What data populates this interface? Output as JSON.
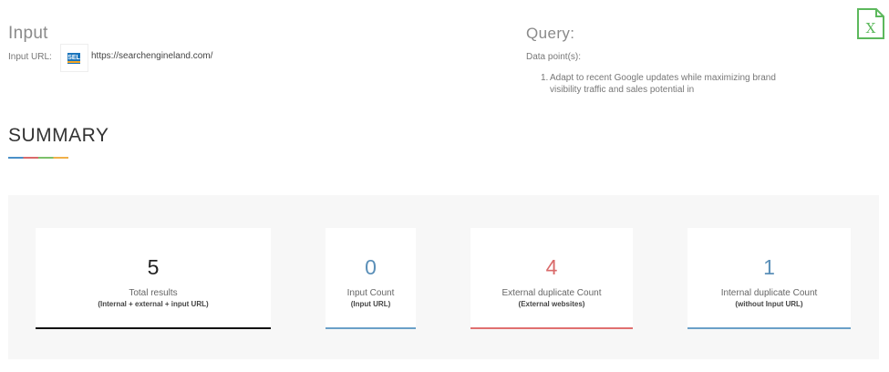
{
  "input": {
    "title": "Input",
    "url_label": "Input URL:",
    "logo_text": "SEL",
    "url_value": "https://searchengineland.com/"
  },
  "query": {
    "title": "Query:",
    "data_points_label": "Data point(s):",
    "items": [
      {
        "number": "1.",
        "text": "Adapt to recent Google updates while maximizing brand visibility traffic and sales potential in"
      }
    ]
  },
  "toolbar": {
    "export_icon": "excel-file-icon",
    "export_letter": "X"
  },
  "summary": {
    "title": "SUMMARY",
    "cards": [
      {
        "value": "5",
        "label": "Total results",
        "sub": "(Internal + external + input URL)",
        "accent": "#111111"
      },
      {
        "value": "0",
        "label": "Input Count",
        "sub": "(Input URL)",
        "accent": "#6aa0c8"
      },
      {
        "value": "4",
        "label": "External duplicate Count",
        "sub": "(External websites)",
        "accent": "#e07070"
      },
      {
        "value": "1",
        "label": "Internal duplicate Count",
        "sub": "(without Input URL)",
        "accent": "#6aa0c8"
      }
    ]
  },
  "colors": {
    "excel_green": "#5cb85c",
    "panel_bg": "#f7f7f7"
  }
}
